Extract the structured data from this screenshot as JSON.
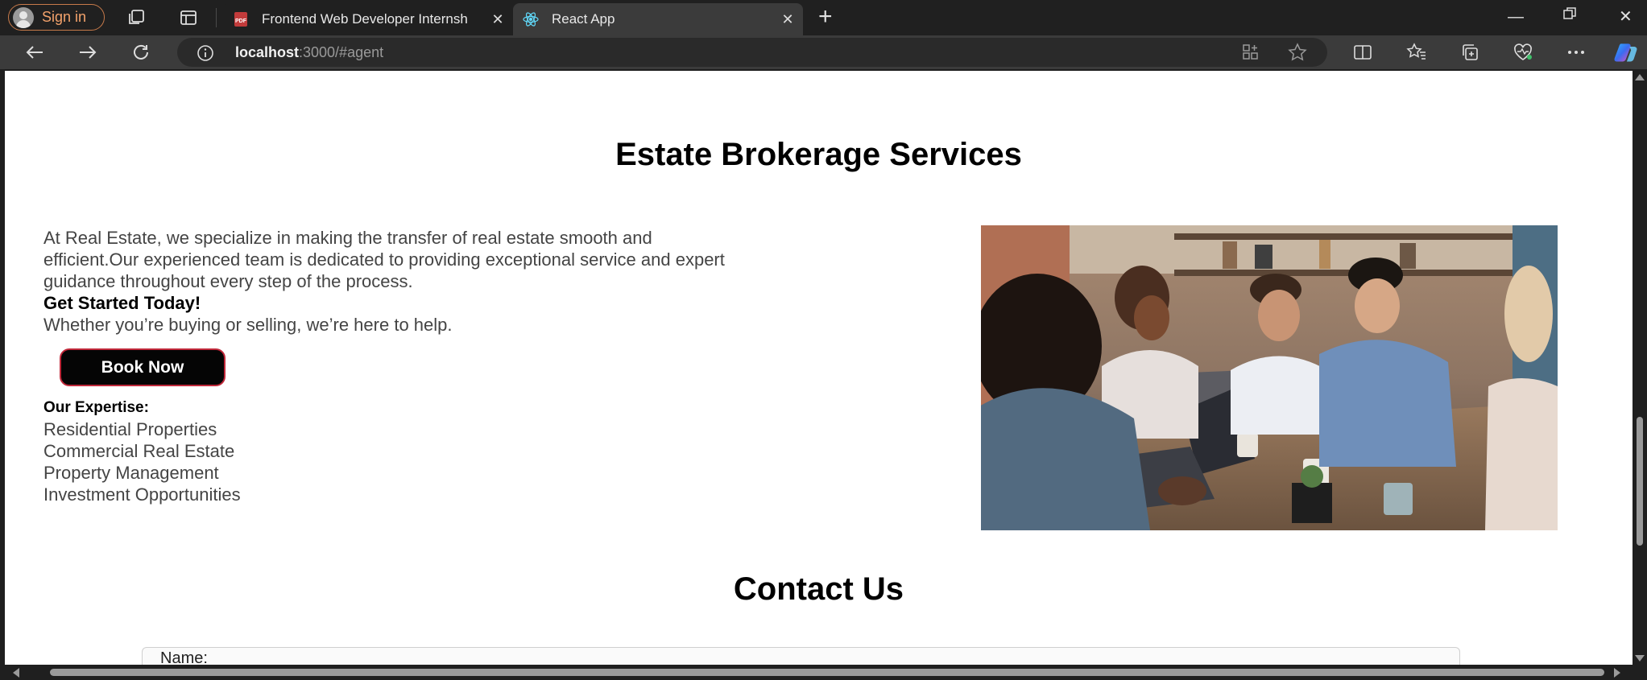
{
  "browser": {
    "profile_label": "Sign in",
    "tabs": [
      {
        "title": "Frontend Web Developer Internsh",
        "icon": "pdf-icon",
        "active": false
      },
      {
        "title": "React App",
        "icon": "react-icon",
        "active": true
      }
    ],
    "url_host": "localhost",
    "url_rest": ":3000/#agent"
  },
  "services": {
    "heading": "Estate Brokerage Services",
    "intro_lines": [
      "At Real Estate, we specialize in making the transfer of real estate smooth and",
      "efficient.Our experienced team is dedicated to providing exceptional service and expert",
      "guidance throughout every step of the process."
    ],
    "cta_title": "Get Started Today!",
    "cta_text": "Whether you’re buying or selling, we’re here to help.",
    "book_button": "Book Now",
    "expertise_title": "Our Expertise:",
    "expertise": [
      "Residential Properties",
      "Commercial Real Estate",
      "Property Management",
      "Investment Opportunities"
    ]
  },
  "contact": {
    "heading": "Contact Us",
    "name_label": "Name:"
  },
  "colors": {
    "button_bg": "#050505",
    "button_border": "#c0283a",
    "signin_accent": "#f3a26b"
  }
}
